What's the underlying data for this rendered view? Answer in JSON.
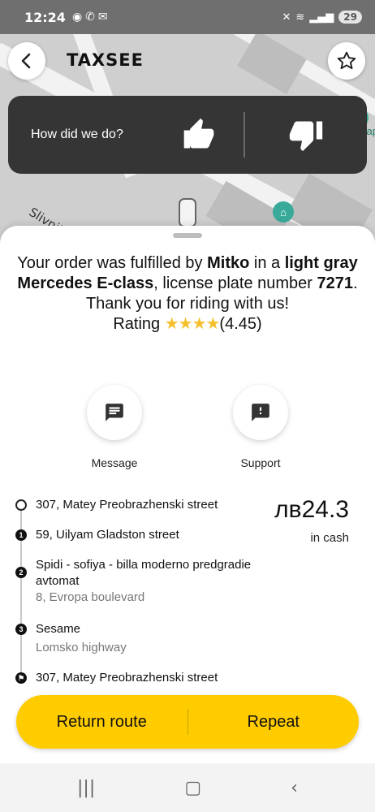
{
  "status_bar": {
    "time": "12:24",
    "battery": "29"
  },
  "header": {
    "logo_text": "TAXSEE"
  },
  "feedback": {
    "prompt": "How did we do?"
  },
  "map": {
    "street_label": "Slivnitsa Blvd.",
    "poi_label": "Метлар"
  },
  "summary": {
    "prefix": "Your order was fulfilled by ",
    "driver": "Mitko",
    "mid": " in a ",
    "car": "light gray Mercedes E-class",
    "plate_prefix": ", license plate number ",
    "plate": "7271",
    "plate_suffix": ".",
    "thanks": "Thank you for riding with us!",
    "rating_label": "Rating ",
    "stars": "★★★★",
    "rating_value": "(4.45)"
  },
  "actions": {
    "message": "Message",
    "support": "Support"
  },
  "route": {
    "stops": [
      {
        "marker": "",
        "title": "307, Matey Preobrazhenski street",
        "sub": ""
      },
      {
        "marker": "1",
        "title": "59, Uilyam Gladston street",
        "sub": ""
      },
      {
        "marker": "2",
        "title": "Spidi - sofiya - billa moderno predgradie avtomat",
        "sub": "8, Evropa boulevard"
      },
      {
        "marker": "3",
        "title": "Sesame",
        "sub": "Lomsko highway"
      },
      {
        "marker": "flag",
        "title": "307, Matey Preobrazhenski street",
        "sub": ""
      }
    ]
  },
  "payment": {
    "price": "лв24.3",
    "method": "in cash"
  },
  "buttons": {
    "return_route": "Return route",
    "repeat": "Repeat"
  },
  "colors": {
    "accent": "#ffcc00",
    "dark_panel": "#353535",
    "poi": "#39a99a"
  }
}
